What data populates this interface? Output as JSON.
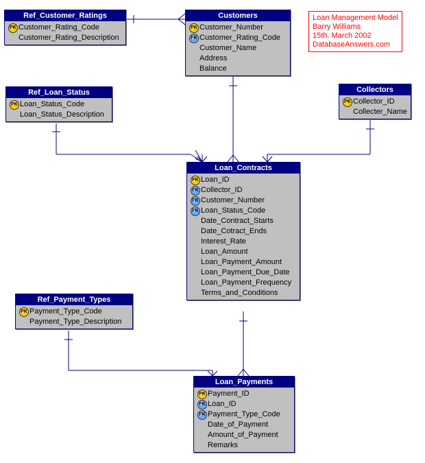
{
  "info": {
    "line1": "Loan Management Model",
    "line2": "Barry Williams",
    "line3": "15th. March 2002",
    "line4": "DatabaseAnswers.com"
  },
  "entities": {
    "ref_customer_ratings": {
      "title": "Ref_Customer_Ratings",
      "attrs": [
        {
          "key": "PK",
          "name": "Customer_Rating_Code"
        },
        {
          "key": "",
          "name": "Customer_Rating_Description"
        }
      ]
    },
    "customers": {
      "title": "Customers",
      "attrs": [
        {
          "key": "PK",
          "name": "Customer_Number"
        },
        {
          "key": "FK",
          "name": "Customer_Rating_Code"
        },
        {
          "key": "",
          "name": "Customer_Name"
        },
        {
          "key": "",
          "name": "Address"
        },
        {
          "key": "",
          "name": "Balance"
        }
      ]
    },
    "collectors": {
      "title": "Collectors",
      "attrs": [
        {
          "key": "PK",
          "name": "Collector_ID"
        },
        {
          "key": "",
          "name": "Collecter_Name"
        }
      ]
    },
    "ref_loan_status": {
      "title": "Ref_Loan_Status",
      "attrs": [
        {
          "key": "PK",
          "name": "Loan_Status_Code"
        },
        {
          "key": "",
          "name": "Loan_Status_Description"
        }
      ]
    },
    "loan_contracts": {
      "title": "Loan_Contracts",
      "attrs": [
        {
          "key": "PK",
          "name": "Loan_ID"
        },
        {
          "key": "FK",
          "name": "Collector_ID"
        },
        {
          "key": "FK",
          "name": "Customer_Number"
        },
        {
          "key": "FK",
          "name": "Loan_Status_Code"
        },
        {
          "key": "",
          "name": "Date_Contract_Starts"
        },
        {
          "key": "",
          "name": "Date_Cotract_Ends"
        },
        {
          "key": "",
          "name": "Interest_Rate"
        },
        {
          "key": "",
          "name": "Loan_Amount"
        },
        {
          "key": "",
          "name": "Loan_Payment_Amount"
        },
        {
          "key": "",
          "name": "Loan_Payment_Due_Date"
        },
        {
          "key": "",
          "name": "Loan_Payment_Frequency"
        },
        {
          "key": "",
          "name": "Terms_and_Conditions"
        }
      ]
    },
    "ref_payment_types": {
      "title": "Ref_Payment_Types",
      "attrs": [
        {
          "key": "PK",
          "name": "Payment_Type_Code"
        },
        {
          "key": "",
          "name": "Payment_Type_Description"
        }
      ]
    },
    "loan_payments": {
      "title": "Loan_Payments",
      "attrs": [
        {
          "key": "PK",
          "name": "Payment_ID"
        },
        {
          "key": "FK",
          "name": "Loan_ID"
        },
        {
          "key": "FK",
          "name": "Payment_Type_Code"
        },
        {
          "key": "",
          "name": "Date_of_Payment"
        },
        {
          "key": "",
          "name": "Amount_of_Payment"
        },
        {
          "key": "",
          "name": "Remarks"
        }
      ]
    }
  },
  "relationships": [
    {
      "from": "ref_customer_ratings",
      "to": "customers",
      "type": "one-to-many"
    },
    {
      "from": "customers",
      "to": "loan_contracts",
      "type": "one-to-many"
    },
    {
      "from": "collectors",
      "to": "loan_contracts",
      "type": "one-to-many"
    },
    {
      "from": "ref_loan_status",
      "to": "loan_contracts",
      "type": "one-to-many"
    },
    {
      "from": "loan_contracts",
      "to": "loan_payments",
      "type": "one-to-many"
    },
    {
      "from": "ref_payment_types",
      "to": "loan_payments",
      "type": "one-to-many"
    }
  ]
}
